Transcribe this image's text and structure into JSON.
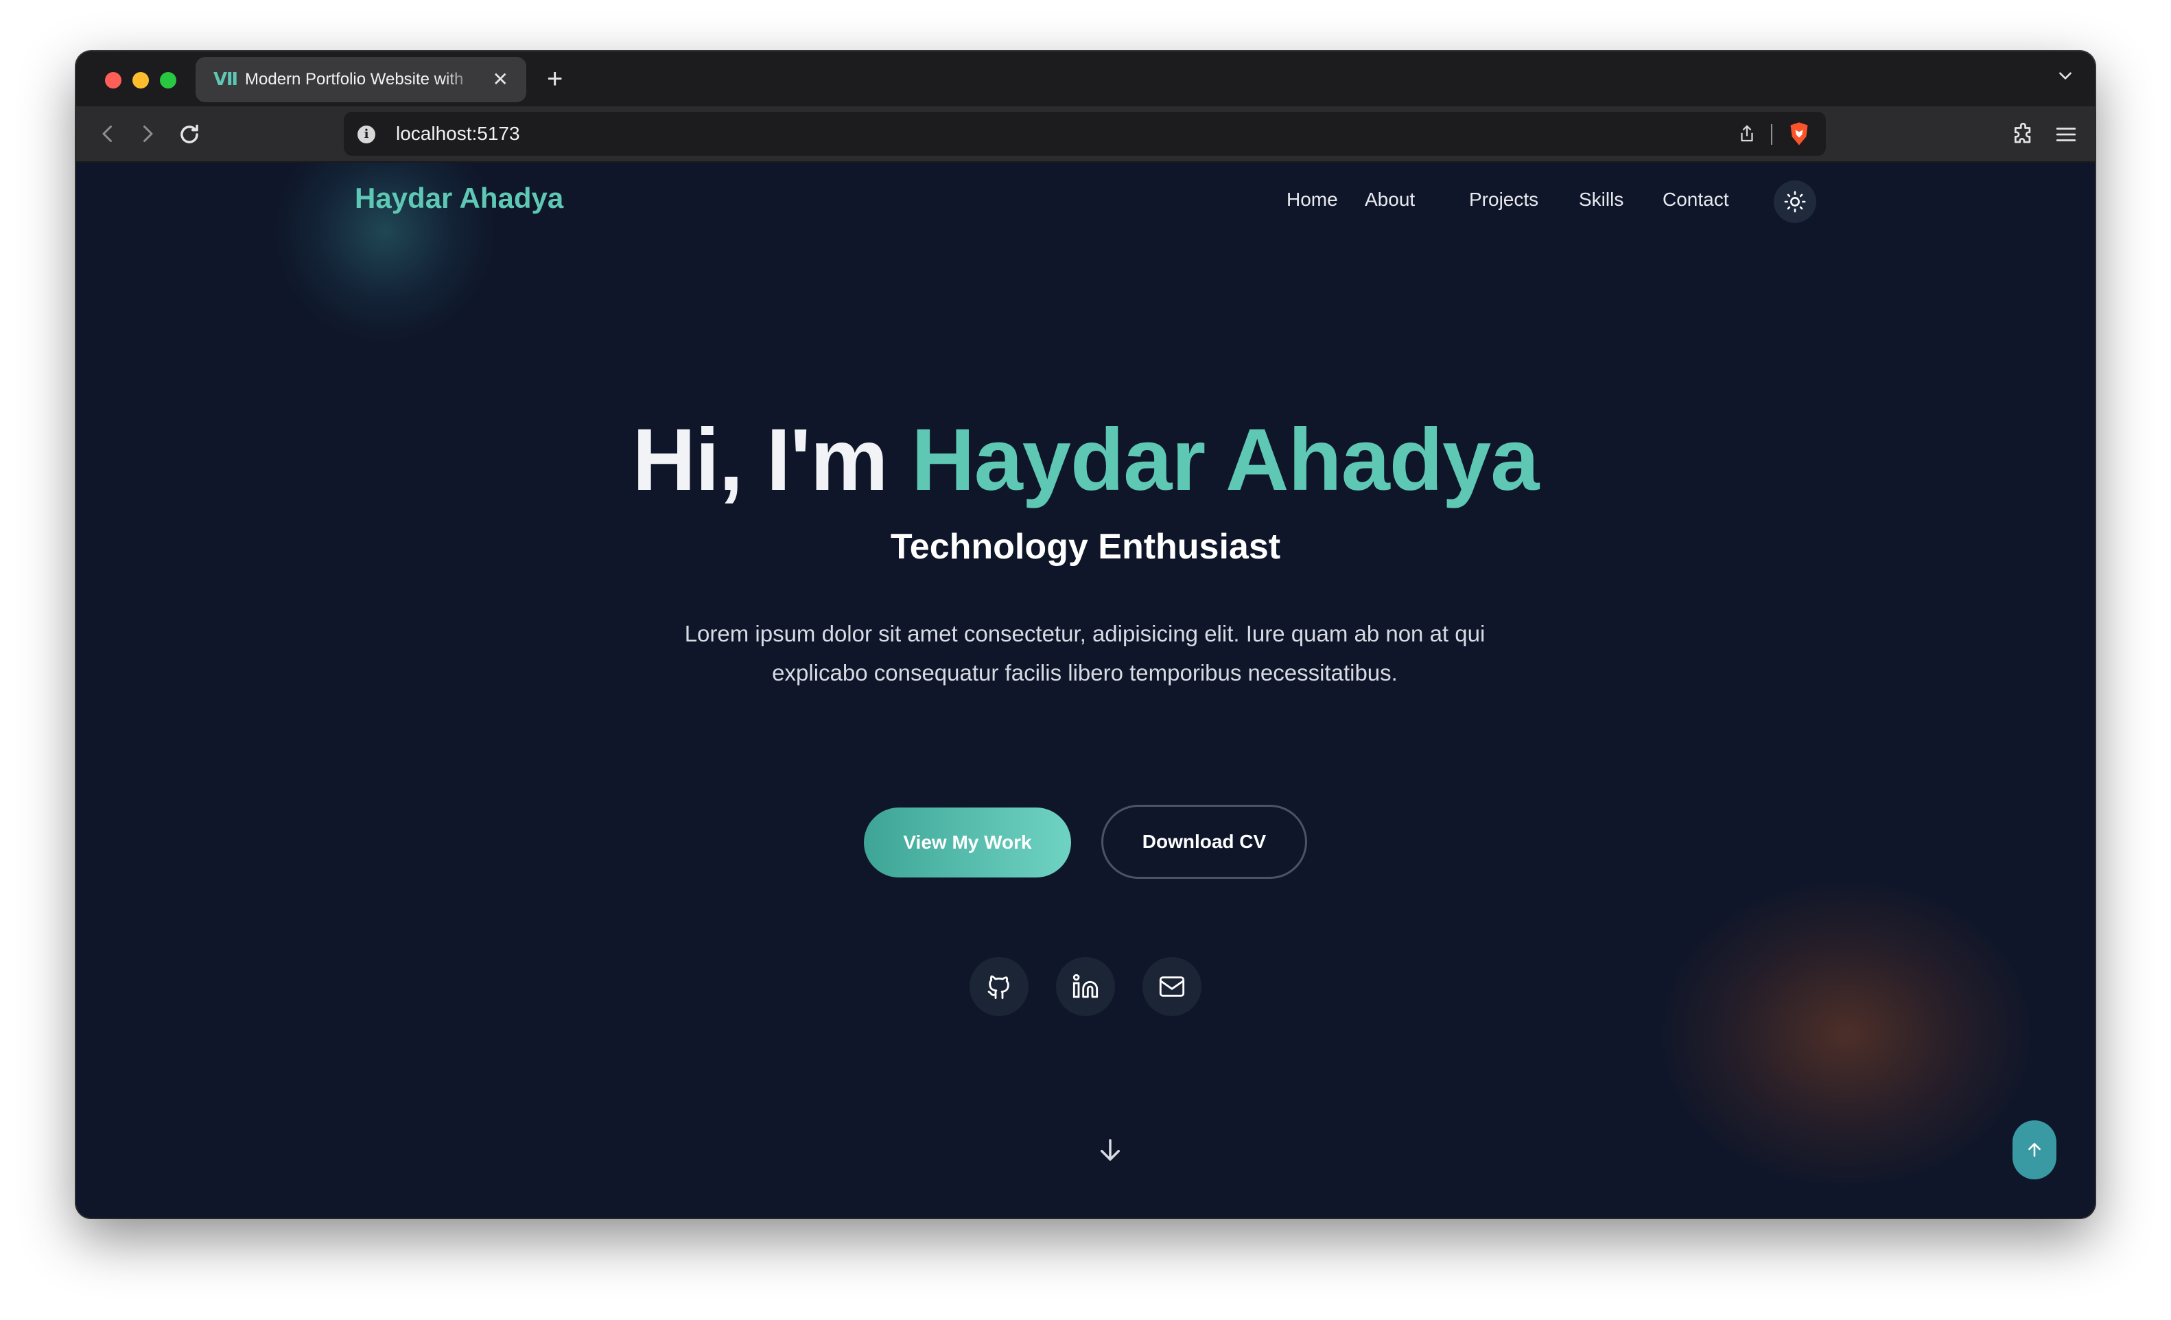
{
  "browser": {
    "tab_title": "Modern Portfolio Website with",
    "url": "localhost:5173",
    "new_tab_label": "+",
    "close_label": "✕"
  },
  "site": {
    "logo": "Haydar Ahadya",
    "nav": [
      "Home",
      "About",
      "Projects",
      "Skills",
      "Contact"
    ]
  },
  "hero": {
    "greeting": "Hi, I'm",
    "name": "Haydar Ahadya",
    "role": "Technology Enthusiast",
    "description": "Lorem ipsum dolor sit amet consectetur, adipisicing elit. Iure quam ab non at qui explicabo consequatur facilis libero temporibus necessitatibus.",
    "primary_button": "View My Work",
    "secondary_button": "Download CV"
  },
  "social": {
    "icons": [
      "github-icon",
      "linkedin-icon",
      "mail-icon"
    ]
  },
  "colors": {
    "accent": "#5ec8b4",
    "background": "#0f1629",
    "to_top": "#3a9aa3"
  }
}
